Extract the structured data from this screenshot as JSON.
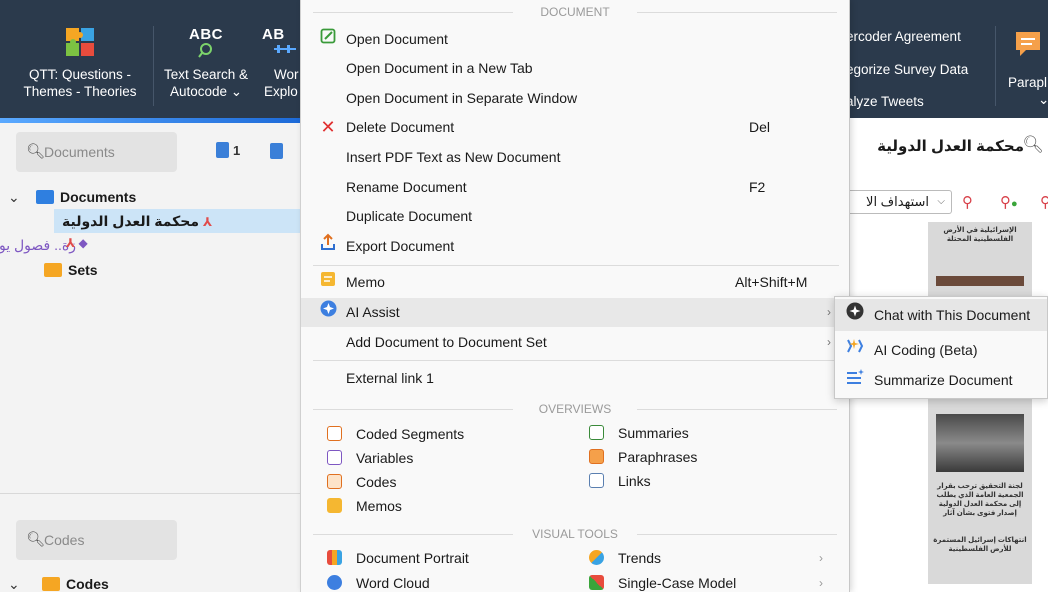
{
  "ribbon": {
    "qtt": {
      "line1": "QTT: Questions -",
      "line2": "Themes - Theories"
    },
    "text_search": {
      "abc": "ABC",
      "line1": "Text Search &",
      "line2": "Autocode ⌄"
    },
    "word_explorer": {
      "abc": "AB",
      "line1": "Wor",
      "line2": "Explo"
    },
    "right_items": [
      "ercoder Agreement",
      "egorize Survey Data",
      "alyze Tweets"
    ],
    "parap": {
      "line1": "Parapl",
      "line2": "⌄"
    }
  },
  "left_panel": {
    "doc_search_placeholder": "Documents",
    "doc_count": "1",
    "tree": {
      "root_label": "Documents",
      "doc1": "محكمة العدل الدولية",
      "doc2": "زة.. فصول يومية من مجازر الاحتلال",
      "sets_label": "Sets"
    },
    "code_search_placeholder": "Codes",
    "codes_label": "Codes"
  },
  "menu": {
    "section_document": "DOCUMENT",
    "items": [
      {
        "label": "Open Document",
        "shortcut": "",
        "arrow": "",
        "icon": "edit-icon"
      },
      {
        "label": "Open Document in a New Tab",
        "shortcut": "",
        "arrow": "",
        "icon": ""
      },
      {
        "label": "Open Document in Separate Window",
        "shortcut": "",
        "arrow": "",
        "icon": ""
      },
      {
        "label": "Delete Document",
        "shortcut": "Del",
        "arrow": "",
        "icon": "delete-x-icon"
      },
      {
        "label": "Insert PDF Text as New Document",
        "shortcut": "",
        "arrow": "",
        "icon": ""
      },
      {
        "label": "Rename Document",
        "shortcut": "F2",
        "arrow": "",
        "icon": ""
      },
      {
        "label": "Duplicate Document",
        "shortcut": "",
        "arrow": "",
        "icon": ""
      },
      {
        "label": "Export Document",
        "shortcut": "",
        "arrow": "",
        "icon": "export-icon"
      },
      {
        "label": "Memo",
        "shortcut": "Alt+Shift+M",
        "arrow": "",
        "icon": "memo-icon"
      },
      {
        "label": "AI Assist",
        "shortcut": "",
        "arrow": "›",
        "icon": "ai-assist-icon"
      },
      {
        "label": "Add Document to Document Set",
        "shortcut": "",
        "arrow": "›",
        "icon": ""
      },
      {
        "label": "External link 1",
        "shortcut": "",
        "arrow": "",
        "icon": ""
      }
    ],
    "section_overviews": "OVERVIEWS",
    "overviews_left": [
      "Coded Segments",
      "Variables",
      "Codes",
      "Memos"
    ],
    "overviews_right": [
      "Summaries",
      "Paraphrases",
      "Links"
    ],
    "section_visual": "VISUAL TOOLS",
    "visual_left": [
      "Document Portrait",
      "Word Cloud"
    ],
    "visual_right": [
      "Trends",
      "Single-Case Model"
    ],
    "visual_arrow": "›"
  },
  "submenu": {
    "items": [
      {
        "label": "Chat with This Document",
        "icon": "chat-ai-icon"
      },
      {
        "label": "AI Coding (Beta)",
        "icon": "ai-coding-icon"
      },
      {
        "label": "Summarize Document",
        "icon": "summarize-icon"
      }
    ]
  },
  "doc_panel": {
    "title": "محكمة العدل الدولية",
    "code_dropdown": "استهداف الا",
    "preview_text1": "الإسرائيلية في الأرض الفلسطينية المحتلة",
    "preview_text2": "لجنة التحقيق ترحب بقرار الجمعية العامة الذي يطلب إلى محكمة العدل الدولية إصدار فتوى بشأن آثار",
    "preview_text3": "انتهاكات إسرائيل المستمرة للأرض الفلسطينية"
  },
  "colors": {
    "ribbon_bg": "#2b3a4c",
    "selection": "#cce4f7",
    "folder_blue": "#2f7fe0",
    "folder_orange": "#f5a623",
    "delete_red": "#e03030",
    "code_red": "#d8414a"
  }
}
